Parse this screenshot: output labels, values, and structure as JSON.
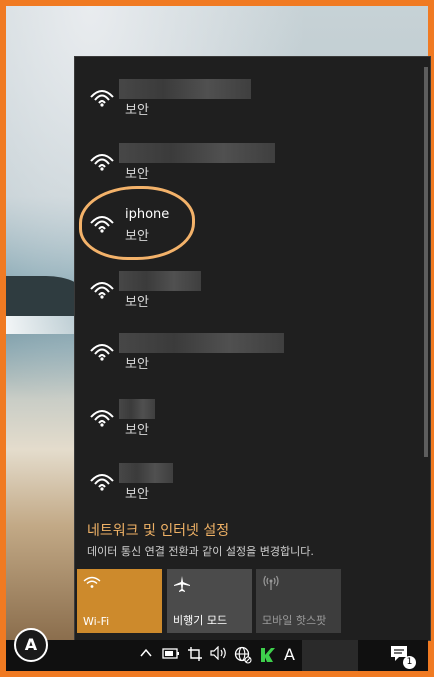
{
  "networks": [
    {
      "name": "",
      "status": "보안",
      "blurred": true,
      "blur_w": 132
    },
    {
      "name": "",
      "status": "보안",
      "blurred": true,
      "blur_w": 156
    },
    {
      "name": "iphone",
      "status": "보안",
      "blurred": false
    },
    {
      "name": "",
      "status": "보안",
      "blurred": true,
      "blur_w": 82
    },
    {
      "name": "",
      "status": "보안",
      "blurred": true,
      "blur_w": 165
    },
    {
      "name": "",
      "status": "보안",
      "blurred": true,
      "blur_w": 36
    },
    {
      "name": "",
      "status": "보안",
      "blurred": true,
      "blur_w": 54
    }
  ],
  "settings": {
    "title": "네트워크 및 인터넷 설정",
    "subtitle": "데이터 통신 연결 전환과 같이 설정을 변경합니다."
  },
  "tiles": {
    "wifi": "Wi-Fi",
    "airplane": "비행기 모드",
    "hotspot": "모바일 핫스팟"
  },
  "taskbar": {
    "ime": "A",
    "notification_count": "1"
  },
  "colors": {
    "accent": "#cd8a2c",
    "link": "#f0b266",
    "highlight_circle": "#f3b26a",
    "frame": "#f07a22"
  }
}
